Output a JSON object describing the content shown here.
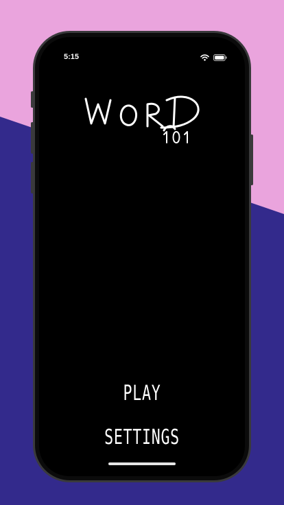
{
  "colors": {
    "background_top": "#eaa4dd",
    "background_bottom": "#332a8c",
    "screen": "#000000",
    "text": "#ffffff"
  },
  "status_bar": {
    "time": "5:15",
    "icons": [
      "wifi-icon",
      "battery-icon"
    ]
  },
  "title": {
    "logo_text": "WORD",
    "logo_subtext": "101"
  },
  "menu": {
    "play_label": "PLAY",
    "settings_label": "SETTINGS"
  }
}
